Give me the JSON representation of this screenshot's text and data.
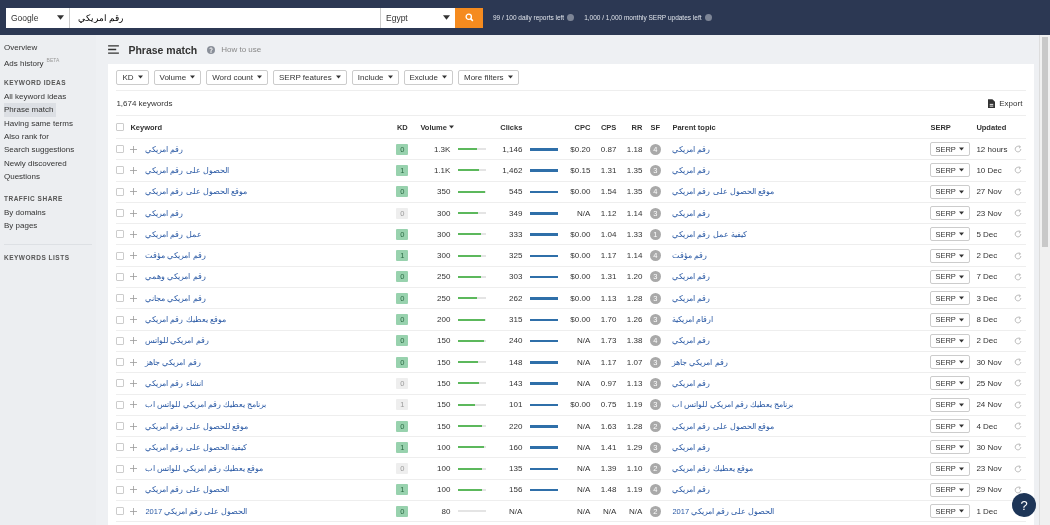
{
  "top_bar": {
    "engine": "Google",
    "query": "رقم امريكي",
    "country": "Egypt",
    "quota": [
      "99 / 100 daily reports left",
      "1,000 / 1,000 monthly SERP updates left"
    ]
  },
  "sidebar": {
    "top_items": [
      {
        "label": "Overview"
      },
      {
        "label": "Ads history",
        "badge": "BETA"
      }
    ],
    "sections": [
      {
        "title": "KEYWORD IDEAS",
        "items": [
          {
            "label": "All keyword ideas",
            "selected": false
          },
          {
            "label": "Phrase match",
            "selected": true
          },
          {
            "label": "Having same terms",
            "selected": false
          },
          {
            "label": "Also rank for",
            "selected": false
          },
          {
            "label": "Search suggestions",
            "selected": false
          },
          {
            "label": "Newly discovered",
            "selected": false
          },
          {
            "label": "Questions",
            "selected": false
          }
        ]
      },
      {
        "title": "TRAFFIC SHARE",
        "items": [
          {
            "label": "By domains",
            "selected": false
          },
          {
            "label": "By pages",
            "selected": false
          }
        ]
      },
      {
        "title": "KEYWORDS LISTS"
      }
    ]
  },
  "page": {
    "title": "Phrase match",
    "help": "How to use"
  },
  "filters": [
    "KD",
    "Volume",
    "Word count",
    "SERP features",
    "Include",
    "Exclude",
    "More filters"
  ],
  "summary": {
    "count": "1,674 keywords",
    "export": "Export"
  },
  "table": {
    "select_all_checked": false,
    "columns": {
      "keyword": "Keyword",
      "kd": "KD",
      "volume": "Volume",
      "clicks": "Clicks",
      "cpc": "CPC",
      "cps": "CPS",
      "rr": "RR",
      "sf": "SF",
      "parent": "Parent topic",
      "serp": "SERP",
      "updated": "Updated"
    },
    "rows": [
      {
        "checked": false,
        "keyword": "رقم امريكي",
        "kd": "0",
        "kd_faded": false,
        "volume": {
          "value": "1.3K",
          "level": 0.65
        },
        "clicks": {
          "value": "1,146",
          "level": 1
        },
        "cpc": "$0.20",
        "cps": "0.87",
        "rr": "1.18",
        "sf": "4",
        "parent": "رقم امريكي",
        "serp": "SERP",
        "updated": "12 hours"
      },
      {
        "checked": false,
        "keyword": "الحصول على رقم امريكي",
        "kd": "1",
        "kd_faded": false,
        "volume": {
          "value": "1.1K",
          "level": 0.75
        },
        "clicks": {
          "value": "1,462",
          "level": 1
        },
        "cpc": "$0.15",
        "cps": "1.31",
        "rr": "1.35",
        "sf": "3",
        "parent": "رقم امريكي",
        "serp": "SERP",
        "updated": "10 Dec"
      },
      {
        "checked": false,
        "keyword": "موقع الحصول على رقم امريكي",
        "kd": "0",
        "kd_faded": false,
        "volume": {
          "value": "350",
          "level": 0.95
        },
        "clicks": {
          "value": "545",
          "level": 1
        },
        "cpc": "$0.00",
        "cps": "1.54",
        "rr": "1.35",
        "sf": "4",
        "parent": "موقع الحصول على رقم امريكي",
        "serp": "SERP",
        "updated": "27 Nov"
      },
      {
        "checked": false,
        "keyword": "رقم امريكي",
        "kd": "0",
        "kd_faded": true,
        "volume": {
          "value": "300",
          "level": 0.7
        },
        "clicks": {
          "value": "349",
          "level": 1
        },
        "cpc": "N/A",
        "cps": "1.12",
        "rr": "1.14",
        "sf": "3",
        "parent": "رقم امريكي",
        "serp": "SERP",
        "updated": "23 Nov"
      },
      {
        "checked": false,
        "keyword": "عمل رقم امريكي",
        "kd": "0",
        "kd_faded": false,
        "volume": {
          "value": "300",
          "level": 0.8
        },
        "clicks": {
          "value": "333",
          "level": 1
        },
        "cpc": "$0.00",
        "cps": "1.04",
        "rr": "1.33",
        "sf": "1",
        "parent": "كيفية عمل رقم امريكي",
        "serp": "SERP",
        "updated": "5 Dec"
      },
      {
        "checked": false,
        "keyword": "رقم امريكي مؤقت",
        "kd": "1",
        "kd_faded": false,
        "volume": {
          "value": "300",
          "level": 0.8
        },
        "clicks": {
          "value": "325",
          "level": 1
        },
        "cpc": "$0.00",
        "cps": "1.17",
        "rr": "1.14",
        "sf": "4",
        "parent": "رقم مؤقت",
        "serp": "SERP",
        "updated": "2 Dec"
      },
      {
        "checked": false,
        "keyword": "رقم امريكي وهمي",
        "kd": "0",
        "kd_faded": false,
        "volume": {
          "value": "250",
          "level": 0.8
        },
        "clicks": {
          "value": "303",
          "level": 1
        },
        "cpc": "$0.00",
        "cps": "1.31",
        "rr": "1.20",
        "sf": "3",
        "parent": "رقم امريكي",
        "serp": "SERP",
        "updated": "7 Dec"
      },
      {
        "checked": false,
        "keyword": "رقم امريكي مجاني",
        "kd": "0",
        "kd_faded": false,
        "volume": {
          "value": "250",
          "level": 0.65
        },
        "clicks": {
          "value": "262",
          "level": 1
        },
        "cpc": "$0.00",
        "cps": "1.13",
        "rr": "1.28",
        "sf": "3",
        "parent": "رقم امريكي",
        "serp": "SERP",
        "updated": "3 Dec"
      },
      {
        "checked": false,
        "keyword": "موقع يعطيك رقم امريكي",
        "kd": "0",
        "kd_faded": false,
        "volume": {
          "value": "200",
          "level": 0.95
        },
        "clicks": {
          "value": "315",
          "level": 1
        },
        "cpc": "$0.00",
        "cps": "1.70",
        "rr": "1.26",
        "sf": "3",
        "parent": "ارقام امريكية",
        "serp": "SERP",
        "updated": "8 Dec"
      },
      {
        "checked": false,
        "keyword": "رقم امريكي للواتس",
        "kd": "0",
        "kd_faded": false,
        "volume": {
          "value": "150",
          "level": 0.9
        },
        "clicks": {
          "value": "240",
          "level": 1
        },
        "cpc": "N/A",
        "cps": "1.73",
        "rr": "1.38",
        "sf": "4",
        "parent": "رقم امريكي",
        "serp": "SERP",
        "updated": "2 Dec"
      },
      {
        "checked": false,
        "keyword": "رقم امريكي جاهز",
        "kd": "0",
        "kd_faded": false,
        "volume": {
          "value": "150",
          "level": 0.7
        },
        "clicks": {
          "value": "148",
          "level": 1
        },
        "cpc": "N/A",
        "cps": "1.17",
        "rr": "1.07",
        "sf": "3",
        "parent": "رقم امريكي جاهز",
        "serp": "SERP",
        "updated": "30 Nov"
      },
      {
        "checked": false,
        "keyword": "انشاء رقم امريكي",
        "kd": "0",
        "kd_faded": true,
        "volume": {
          "value": "150",
          "level": 0.75
        },
        "clicks": {
          "value": "143",
          "level": 1
        },
        "cpc": "N/A",
        "cps": "0.97",
        "rr": "1.13",
        "sf": "3",
        "parent": "رقم امريكي",
        "serp": "SERP",
        "updated": "25 Nov"
      },
      {
        "checked": false,
        "keyword": "برنامج يعطيك رقم امريكي للواتس اب",
        "kd": "1",
        "kd_faded": true,
        "volume": {
          "value": "150",
          "level": 0.6
        },
        "clicks": {
          "value": "101",
          "level": 1
        },
        "cpc": "$0.00",
        "cps": "0.75",
        "rr": "1.19",
        "sf": "3",
        "parent": "برنامج يعطيك رقم امريكي للواتس اب",
        "serp": "SERP",
        "updated": "24 Nov"
      },
      {
        "checked": false,
        "keyword": "موقع للحصول على رقم امريكي",
        "kd": "0",
        "kd_faded": false,
        "volume": {
          "value": "150",
          "level": 0.85
        },
        "clicks": {
          "value": "220",
          "level": 1
        },
        "cpc": "N/A",
        "cps": "1.63",
        "rr": "1.28",
        "sf": "2",
        "parent": "موقع الحصول على رقم امريكي",
        "serp": "SERP",
        "updated": "4 Dec"
      },
      {
        "checked": false,
        "keyword": "كيفية الحصول على رقم امريكي",
        "kd": "1",
        "kd_faded": false,
        "volume": {
          "value": "100",
          "level": 0.9
        },
        "clicks": {
          "value": "160",
          "level": 1
        },
        "cpc": "N/A",
        "cps": "1.41",
        "rr": "1.29",
        "sf": "3",
        "parent": "رقم امريكي",
        "serp": "SERP",
        "updated": "30 Nov"
      },
      {
        "checked": false,
        "keyword": "موقع يعطيك رقم امريكي للواتس اب",
        "kd": "0",
        "kd_faded": true,
        "volume": {
          "value": "100",
          "level": 0.85
        },
        "clicks": {
          "value": "135",
          "level": 1
        },
        "cpc": "N/A",
        "cps": "1.39",
        "rr": "1.10",
        "sf": "2",
        "parent": "موقع يعطيك رقم امريكي",
        "serp": "SERP",
        "updated": "23 Nov"
      },
      {
        "checked": false,
        "keyword": "الحصول على رقم امريكي",
        "kd": "1",
        "kd_faded": false,
        "volume": {
          "value": "100",
          "level": 0.85
        },
        "clicks": {
          "value": "156",
          "level": 1
        },
        "cpc": "N/A",
        "cps": "1.48",
        "rr": "1.19",
        "sf": "4",
        "parent": "رقم امريكي",
        "serp": "SERP",
        "updated": "29 Nov"
      },
      {
        "checked": false,
        "keyword": "الحصول على رقم امريكي 2017",
        "kd": "0",
        "kd_faded": false,
        "volume": {
          "value": "80",
          "level": 0
        },
        "clicks": {
          "value": "N/A"
        },
        "cpc": "N/A",
        "cps": "N/A",
        "rr": "N/A",
        "sf": "2",
        "parent": "الحصول على رقم امريكي 2017",
        "serp": "SERP",
        "updated": "1 Dec"
      }
    ]
  },
  "help_button": "?"
}
